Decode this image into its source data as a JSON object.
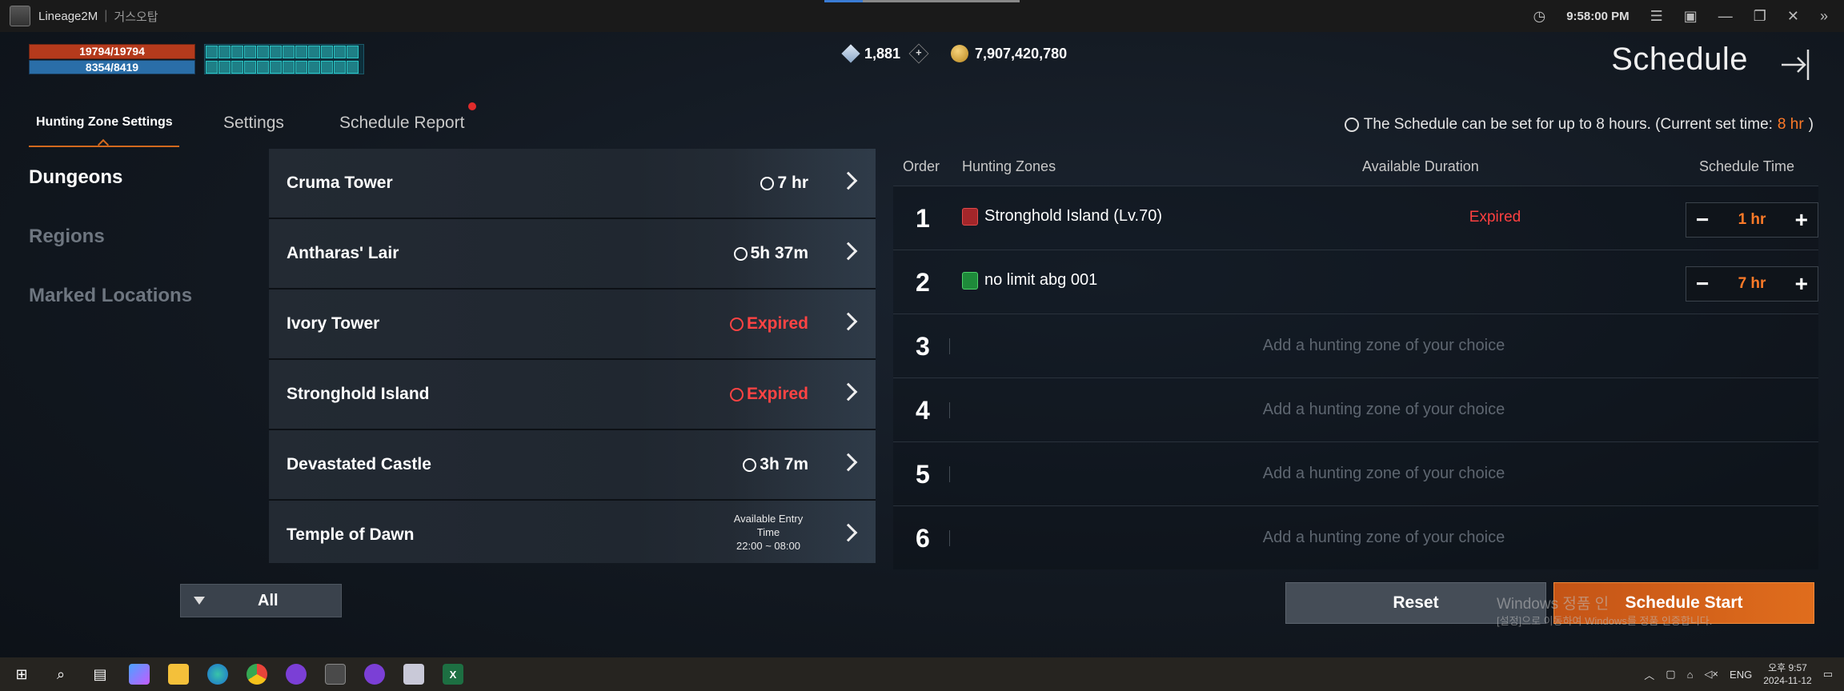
{
  "window": {
    "app_name": "Lineage2M",
    "server": "거스오탑",
    "clock": "9:58:00 PM"
  },
  "hud": {
    "hp": "19794/19794",
    "mp": "8354/8419",
    "diamonds": "1,881",
    "adena": "7,907,420,780"
  },
  "header": {
    "title": "Schedule"
  },
  "tabs": [
    {
      "label": "Hunting Zone Settings"
    },
    {
      "label": "Settings"
    },
    {
      "label": "Schedule Report"
    }
  ],
  "notice": {
    "text": "The Schedule can be set for up to 8 hours. (Current set time: ",
    "highlight": "8 hr",
    "close": ")"
  },
  "categories": [
    {
      "label": "Dungeons"
    },
    {
      "label": "Regions"
    },
    {
      "label": "Marked Locations"
    }
  ],
  "dungeons": [
    {
      "name": "Cruma Tower",
      "duration": "7 hr"
    },
    {
      "name": "Antharas' Lair",
      "duration": "5h 37m"
    },
    {
      "name": "Ivory Tower",
      "duration": "Expired"
    },
    {
      "name": "Stronghold Island",
      "duration": "Expired"
    },
    {
      "name": "Devastated Castle",
      "duration": "3h 7m"
    },
    {
      "name": "Temple of Dawn",
      "entry_label_1": "Available Entry",
      "entry_label_2": "Time",
      "entry_time": "22:00 ~ 08:00"
    }
  ],
  "schedule_table": {
    "headers": {
      "order": "Order",
      "zones": "Hunting Zones",
      "available": "Available Duration",
      "time": "Schedule Time"
    },
    "rows": [
      {
        "order": "1",
        "zone": "Stronghold Island (Lv.70)",
        "available": "Expired",
        "time": "1 hr"
      },
      {
        "order": "2",
        "zone": "no limit abg 001",
        "available": "",
        "time": "7 hr"
      },
      {
        "order": "3",
        "placeholder": "Add a hunting zone of your choice"
      },
      {
        "order": "4",
        "placeholder": "Add a hunting zone of your choice"
      },
      {
        "order": "5",
        "placeholder": "Add a hunting zone of your choice"
      },
      {
        "order": "6",
        "placeholder": "Add a hunting zone of your choice"
      }
    ],
    "minus": "−",
    "plus": "+"
  },
  "footer": {
    "filter": "All",
    "reset": "Reset",
    "start": "Schedule Start"
  },
  "watermark": {
    "line1": "Windows 정품 인",
    "line2": "[설정]으로 이동하여 Windows를 정품 인증합니다."
  },
  "taskbar": {
    "lang": "ENG",
    "time": "오후 9:57",
    "date": "2024-11-12"
  }
}
